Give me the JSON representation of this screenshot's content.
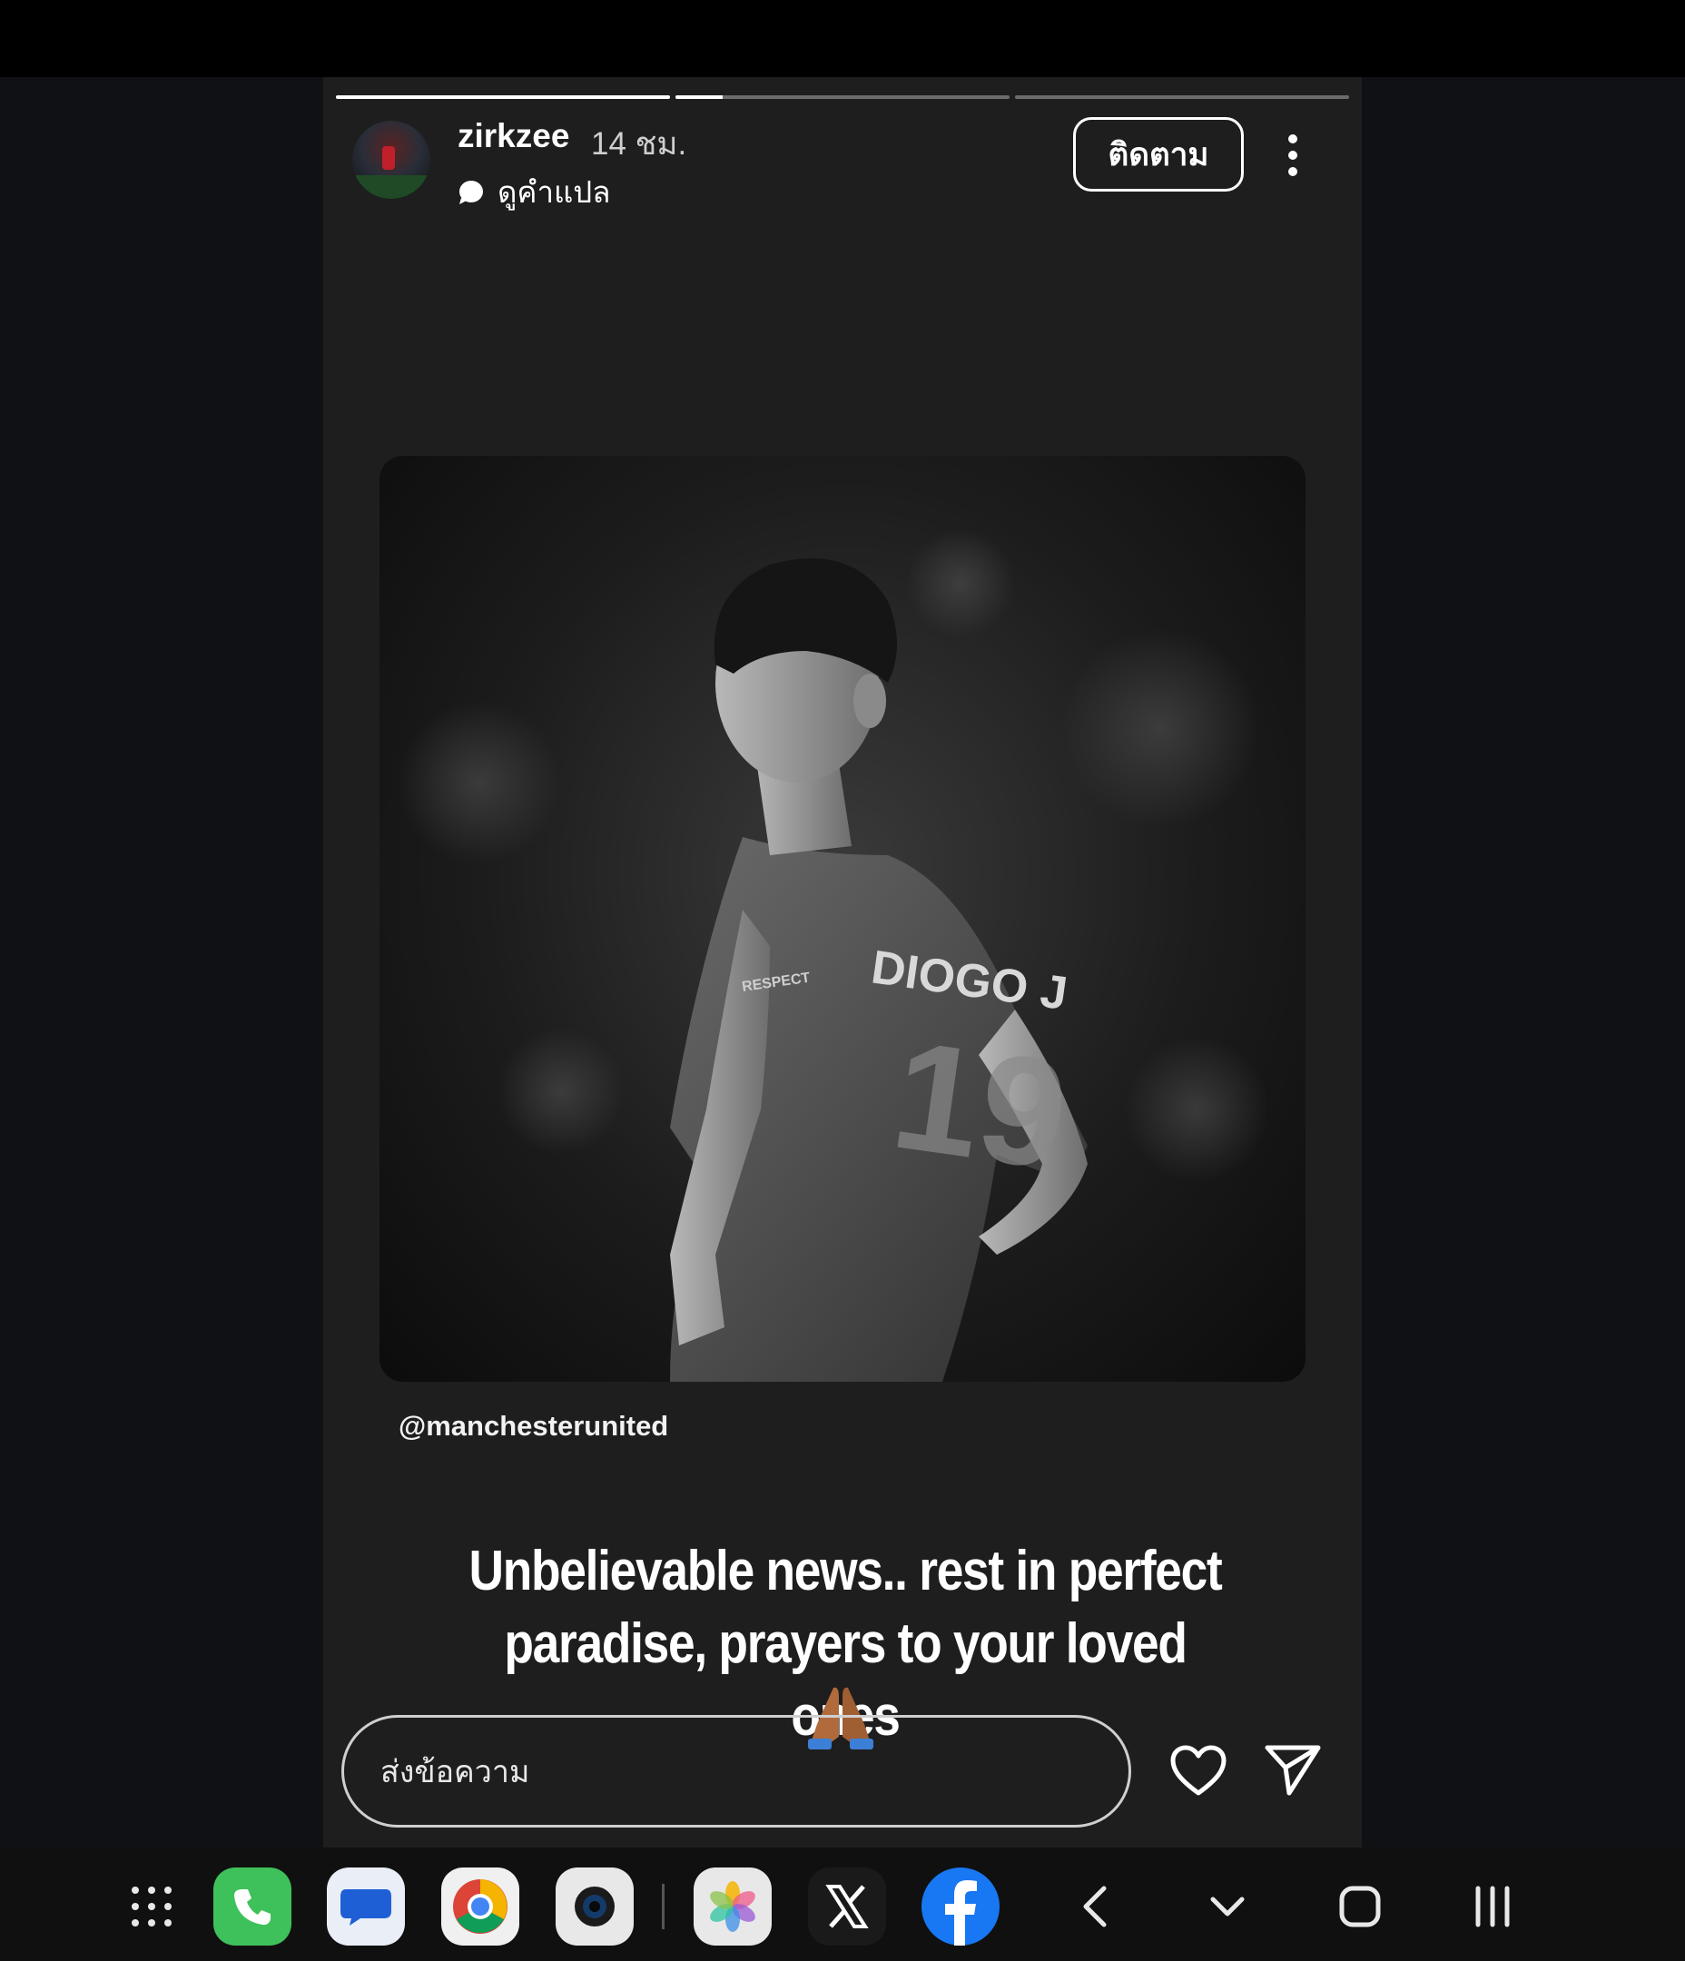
{
  "story": {
    "username": "zirkzee",
    "time": "14 ชม.",
    "translate_label": "ดูคำแปล",
    "follow_label": "ติดตาม",
    "progress_segments": [
      1.0,
      0.14,
      0.0
    ],
    "post": {
      "jersey_name": "DIOGO J",
      "jersey_number": "19",
      "sleeve_text": "RESPECT"
    },
    "mention": "@manchesterunited",
    "caption": "Unbelievable news.. rest in perfect paradise, prayers to your loved ones",
    "caption_emoji": "pray-emoji",
    "message_placeholder": "ส่งข้อความ"
  },
  "taskbar": {
    "apps": [
      "app-drawer",
      "phone",
      "messages",
      "chrome",
      "camera",
      "photos",
      "x",
      "facebook"
    ],
    "nav": [
      "back",
      "hide-keyboard",
      "home",
      "recents"
    ]
  },
  "colors": {
    "background": "#0f1114",
    "story_bg": "#1e1e1e",
    "phone_green": "#3ec15a",
    "facebook_blue": "#1877f2"
  }
}
